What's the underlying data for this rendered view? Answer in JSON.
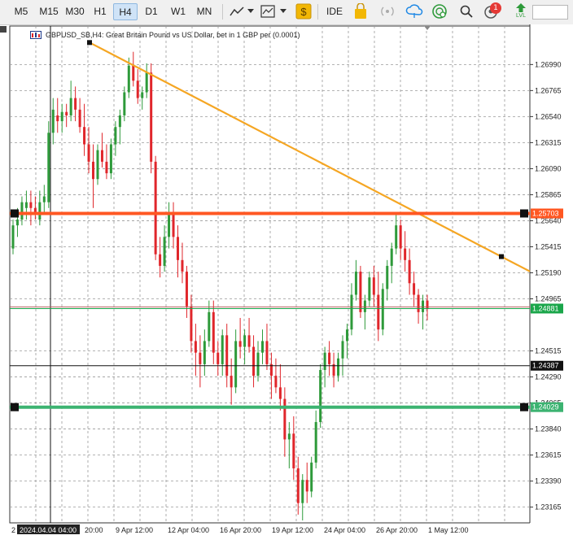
{
  "toolbar": {
    "timeframes": [
      "M5",
      "M15",
      "M30",
      "H1",
      "H4",
      "D1",
      "W1",
      "MN"
    ],
    "active_timeframe": "H4",
    "ide_label": "IDE",
    "notification_count": "1",
    "lvl_label": "LVL",
    "accent_color": "#1e88e5",
    "icons": [
      "line-chart-icon",
      "dropdown-icon",
      "template-icon",
      "dropdown-icon",
      "dollar-icon",
      "ide-icon",
      "shopping-bag-icon",
      "signal-icon",
      "cloud-icon",
      "globe-icon",
      "search-icon",
      "notifications-icon",
      "lvl-icon"
    ]
  },
  "chart": {
    "title": "GBPUSD_SB,H4:  Great Britain Pound vs US Dollar, bet in 1 GBP per (0.0001)",
    "background": "#ffffff",
    "bull_color": "#2e9a3a",
    "bear_color": "#e0262b",
    "price_ticks": [
      "1.26990",
      "1.26765",
      "1.26540",
      "1.26315",
      "1.26090",
      "1.25865",
      "1.25640",
      "1.25415",
      "1.25190",
      "1.24965",
      "1.24515",
      "1.24290",
      "1.24065",
      "1.23840",
      "1.23615",
      "1.23390",
      "1.23165"
    ],
    "time_labels": [
      "2",
      "2024.04.04 04:00",
      "20:00",
      "9 Apr 12:00",
      "12 Apr 04:00",
      "16 Apr 20:00",
      "19 Apr 12:00",
      "24 Apr 04:00",
      "26 Apr 20:00",
      "1 May 12:00"
    ],
    "levels": {
      "resistance": {
        "price": 1.25703,
        "label": "1.25703",
        "color": "#ff5722"
      },
      "bid": {
        "price": 1.24881,
        "label": "1.24881",
        "color": "#1aa64a"
      },
      "crosshair": {
        "price": 1.24387,
        "label": "1.24387"
      },
      "support": {
        "price": 1.24029,
        "label": "1.24029",
        "color": "#3cb371"
      }
    },
    "trendline": {
      "color": "#f5a623",
      "from": {
        "date": "2024-04-04 08:00",
        "price": 1.2718
      },
      "to": {
        "date": "2024-05-02 16:00",
        "price": 1.2533
      }
    }
  },
  "chart_data": {
    "type": "candlestick",
    "symbol": "GBPUSD_SB",
    "timeframe": "H4",
    "y_range": [
      1.2305,
      1.2714
    ],
    "candles": [
      [
        1.254,
        1.2565,
        1.2535,
        1.256
      ],
      [
        1.256,
        1.2575,
        1.255,
        1.2565
      ],
      [
        1.2565,
        1.2585,
        1.256,
        1.258
      ],
      [
        1.2575,
        1.259,
        1.2565,
        1.258
      ],
      [
        1.258,
        1.259,
        1.256,
        1.2575
      ],
      [
        1.2575,
        1.2585,
        1.2565,
        1.257
      ],
      [
        1.2565,
        1.259,
        1.256,
        1.258
      ],
      [
        1.258,
        1.2595,
        1.257,
        1.2585
      ],
      [
        1.258,
        1.265,
        1.2575,
        1.264
      ],
      [
        1.264,
        1.267,
        1.263,
        1.266
      ],
      [
        1.2655,
        1.267,
        1.264,
        1.265
      ],
      [
        1.265,
        1.2665,
        1.264,
        1.2658
      ],
      [
        1.2658,
        1.2665,
        1.2645,
        1.2655
      ],
      [
        1.2655,
        1.2685,
        1.265,
        1.267
      ],
      [
        1.267,
        1.268,
        1.265,
        1.266
      ],
      [
        1.266,
        1.267,
        1.264,
        1.2645
      ],
      [
        1.2645,
        1.2665,
        1.262,
        1.263
      ],
      [
        1.263,
        1.2645,
        1.2605,
        1.2615
      ],
      [
        1.2615,
        1.263,
        1.2575,
        1.26
      ],
      [
        1.26,
        1.263,
        1.2595,
        1.2625
      ],
      [
        1.2625,
        1.264,
        1.261,
        1.2615
      ],
      [
        1.2615,
        1.263,
        1.26,
        1.2605
      ],
      [
        1.2605,
        1.2635,
        1.26,
        1.263
      ],
      [
        1.263,
        1.265,
        1.262,
        1.2645
      ],
      [
        1.2645,
        1.266,
        1.263,
        1.2655
      ],
      [
        1.2655,
        1.268,
        1.265,
        1.2675
      ],
      [
        1.2675,
        1.2705,
        1.267,
        1.2698
      ],
      [
        1.2698,
        1.271,
        1.268,
        1.2685
      ],
      [
        1.2685,
        1.2695,
        1.2665,
        1.267
      ],
      [
        1.267,
        1.268,
        1.266,
        1.2675
      ],
      [
        1.2675,
        1.27,
        1.267,
        1.2692
      ],
      [
        1.2692,
        1.27,
        1.2605,
        1.2615
      ],
      [
        1.2615,
        1.262,
        1.253,
        1.2535
      ],
      [
        1.2535,
        1.255,
        1.2515,
        1.2525
      ],
      [
        1.2525,
        1.256,
        1.252,
        1.255
      ],
      [
        1.255,
        1.258,
        1.254,
        1.257
      ],
      [
        1.257,
        1.258,
        1.254,
        1.255
      ],
      [
        1.255,
        1.256,
        1.2515,
        1.253
      ],
      [
        1.253,
        1.2545,
        1.251,
        1.252
      ],
      [
        1.252,
        1.2525,
        1.248,
        1.249
      ],
      [
        1.249,
        1.25,
        1.245,
        1.246
      ],
      [
        1.246,
        1.2475,
        1.243,
        1.245
      ],
      [
        1.245,
        1.2465,
        1.242,
        1.244
      ],
      [
        1.244,
        1.247,
        1.243,
        1.246
      ],
      [
        1.246,
        1.2495,
        1.2455,
        1.2485
      ],
      [
        1.2485,
        1.2495,
        1.244,
        1.245
      ],
      [
        1.245,
        1.246,
        1.243,
        1.244
      ],
      [
        1.244,
        1.247,
        1.243,
        1.2465
      ],
      [
        1.2465,
        1.2475,
        1.242,
        1.243
      ],
      [
        1.243,
        1.2445,
        1.2405,
        1.242
      ],
      [
        1.242,
        1.247,
        1.2415,
        1.246
      ],
      [
        1.246,
        1.248,
        1.2445,
        1.2455
      ],
      [
        1.2455,
        1.247,
        1.244,
        1.2465
      ],
      [
        1.2465,
        1.248,
        1.245,
        1.2455
      ],
      [
        1.2455,
        1.2465,
        1.242,
        1.243
      ],
      [
        1.243,
        1.246,
        1.2425,
        1.245
      ],
      [
        1.245,
        1.247,
        1.244,
        1.246
      ],
      [
        1.246,
        1.2475,
        1.2435,
        1.244
      ],
      [
        1.244,
        1.245,
        1.241,
        1.243
      ],
      [
        1.243,
        1.2445,
        1.2415,
        1.242
      ],
      [
        1.242,
        1.244,
        1.24,
        1.241
      ],
      [
        1.241,
        1.242,
        1.236,
        1.2375
      ],
      [
        1.2375,
        1.239,
        1.235,
        1.238
      ],
      [
        1.238,
        1.2395,
        1.234,
        1.235
      ],
      [
        1.235,
        1.236,
        1.231,
        1.232
      ],
      [
        1.232,
        1.2345,
        1.2305,
        1.234
      ],
      [
        1.234,
        1.2355,
        1.232,
        1.233
      ],
      [
        1.233,
        1.236,
        1.2325,
        1.2355
      ],
      [
        1.2355,
        1.24,
        1.235,
        1.239
      ],
      [
        1.239,
        1.244,
        1.2385,
        1.2435
      ],
      [
        1.2435,
        1.2455,
        1.242,
        1.245
      ],
      [
        1.245,
        1.246,
        1.243,
        1.244
      ],
      [
        1.244,
        1.245,
        1.242,
        1.243
      ],
      [
        1.243,
        1.245,
        1.2425,
        1.2445
      ],
      [
        1.2445,
        1.2465,
        1.243,
        1.246
      ],
      [
        1.246,
        1.2475,
        1.2445,
        1.247
      ],
      [
        1.247,
        1.251,
        1.2465,
        1.25
      ],
      [
        1.25,
        1.253,
        1.2495,
        1.252
      ],
      [
        1.252,
        1.2525,
        1.248,
        1.2485
      ],
      [
        1.2485,
        1.25,
        1.247,
        1.2495
      ],
      [
        1.2495,
        1.252,
        1.249,
        1.2515
      ],
      [
        1.2515,
        1.2525,
        1.249,
        1.25
      ],
      [
        1.25,
        1.252,
        1.246,
        1.247
      ],
      [
        1.247,
        1.251,
        1.2465,
        1.2505
      ],
      [
        1.2505,
        1.253,
        1.2495,
        1.2525
      ],
      [
        1.2525,
        1.2545,
        1.251,
        1.254
      ],
      [
        1.254,
        1.257,
        1.2535,
        1.256
      ],
      [
        1.256,
        1.2565,
        1.253,
        1.254
      ],
      [
        1.254,
        1.2555,
        1.252,
        1.253
      ],
      [
        1.253,
        1.254,
        1.25,
        1.251
      ],
      [
        1.251,
        1.252,
        1.249,
        1.25
      ],
      [
        1.25,
        1.2505,
        1.2475,
        1.2485
      ],
      [
        1.2485,
        1.25,
        1.247,
        1.2495
      ],
      [
        1.2495,
        1.25,
        1.2478,
        1.2488
      ]
    ]
  }
}
